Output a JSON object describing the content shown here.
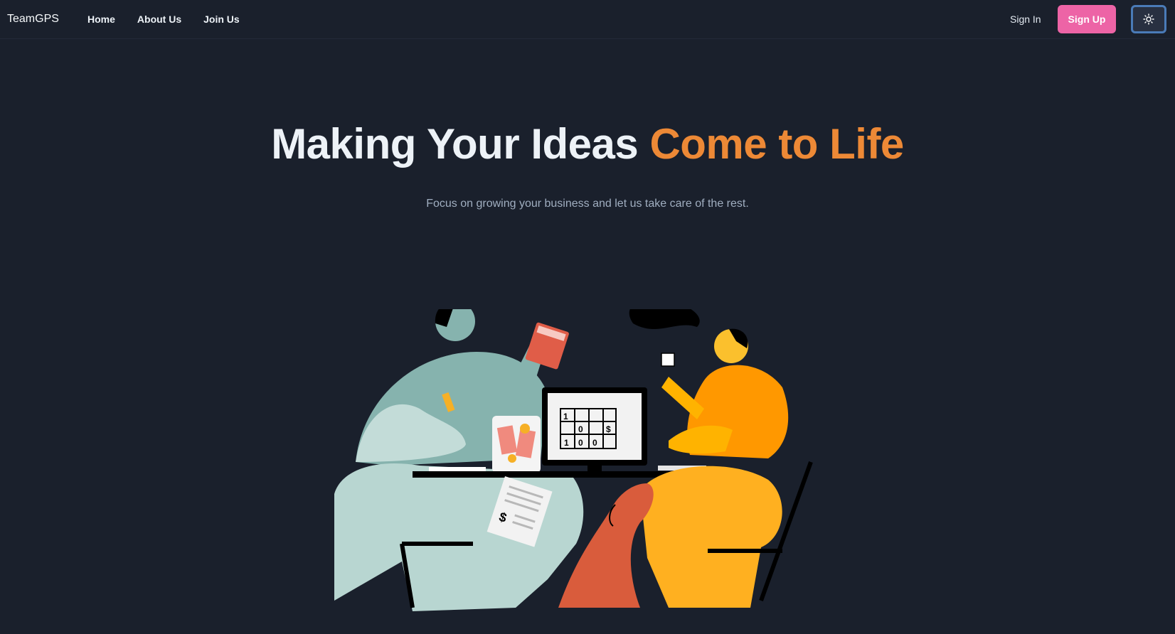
{
  "navbar": {
    "brand": "TeamGPS",
    "links": [
      {
        "label": "Home"
      },
      {
        "label": "About Us"
      },
      {
        "label": "Join Us"
      }
    ],
    "sign_in": "Sign In",
    "sign_up": "Sign Up",
    "theme_toggle_icon": "sun-icon"
  },
  "hero": {
    "title_main": "Making Your Ideas",
    "title_accent": "Come to Life",
    "subtitle": "Focus on growing your business and let us take care of the rest."
  },
  "illustration": {
    "screen_cells": [
      "1",
      "0",
      "$",
      "1",
      "0",
      "0"
    ],
    "receipt_symbol": "$"
  },
  "colors": {
    "background": "#1a202c",
    "accent": "#ed8936",
    "sign_up": "#ed64a6",
    "toggle_border": "#4a7bb8"
  }
}
